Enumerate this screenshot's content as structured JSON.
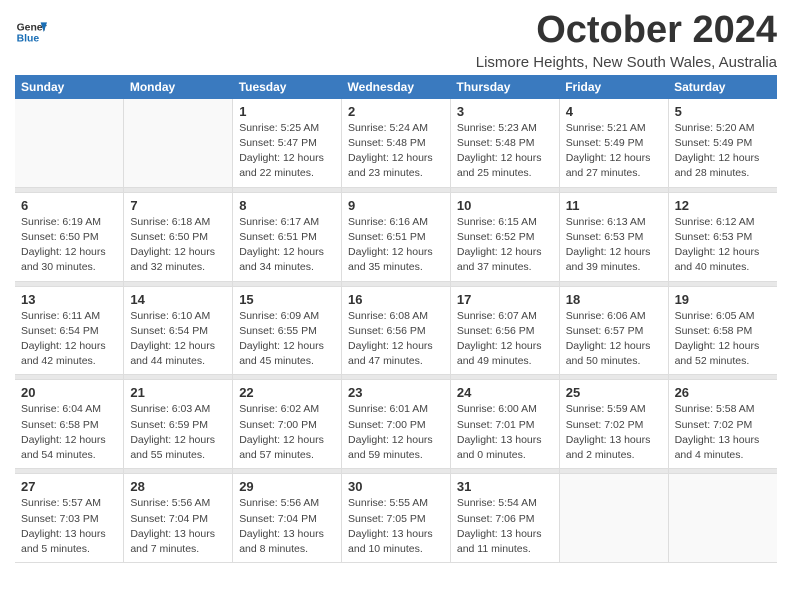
{
  "logo": {
    "line1": "General",
    "line2": "Blue"
  },
  "title": "October 2024",
  "subtitle": "Lismore Heights, New South Wales, Australia",
  "days_of_week": [
    "Sunday",
    "Monday",
    "Tuesday",
    "Wednesday",
    "Thursday",
    "Friday",
    "Saturday"
  ],
  "weeks": [
    [
      {
        "num": "",
        "info": ""
      },
      {
        "num": "",
        "info": ""
      },
      {
        "num": "1",
        "info": "Sunrise: 5:25 AM\nSunset: 5:47 PM\nDaylight: 12 hours\nand 22 minutes."
      },
      {
        "num": "2",
        "info": "Sunrise: 5:24 AM\nSunset: 5:48 PM\nDaylight: 12 hours\nand 23 minutes."
      },
      {
        "num": "3",
        "info": "Sunrise: 5:23 AM\nSunset: 5:48 PM\nDaylight: 12 hours\nand 25 minutes."
      },
      {
        "num": "4",
        "info": "Sunrise: 5:21 AM\nSunset: 5:49 PM\nDaylight: 12 hours\nand 27 minutes."
      },
      {
        "num": "5",
        "info": "Sunrise: 5:20 AM\nSunset: 5:49 PM\nDaylight: 12 hours\nand 28 minutes."
      }
    ],
    [
      {
        "num": "6",
        "info": "Sunrise: 6:19 AM\nSunset: 6:50 PM\nDaylight: 12 hours\nand 30 minutes."
      },
      {
        "num": "7",
        "info": "Sunrise: 6:18 AM\nSunset: 6:50 PM\nDaylight: 12 hours\nand 32 minutes."
      },
      {
        "num": "8",
        "info": "Sunrise: 6:17 AM\nSunset: 6:51 PM\nDaylight: 12 hours\nand 34 minutes."
      },
      {
        "num": "9",
        "info": "Sunrise: 6:16 AM\nSunset: 6:51 PM\nDaylight: 12 hours\nand 35 minutes."
      },
      {
        "num": "10",
        "info": "Sunrise: 6:15 AM\nSunset: 6:52 PM\nDaylight: 12 hours\nand 37 minutes."
      },
      {
        "num": "11",
        "info": "Sunrise: 6:13 AM\nSunset: 6:53 PM\nDaylight: 12 hours\nand 39 minutes."
      },
      {
        "num": "12",
        "info": "Sunrise: 6:12 AM\nSunset: 6:53 PM\nDaylight: 12 hours\nand 40 minutes."
      }
    ],
    [
      {
        "num": "13",
        "info": "Sunrise: 6:11 AM\nSunset: 6:54 PM\nDaylight: 12 hours\nand 42 minutes."
      },
      {
        "num": "14",
        "info": "Sunrise: 6:10 AM\nSunset: 6:54 PM\nDaylight: 12 hours\nand 44 minutes."
      },
      {
        "num": "15",
        "info": "Sunrise: 6:09 AM\nSunset: 6:55 PM\nDaylight: 12 hours\nand 45 minutes."
      },
      {
        "num": "16",
        "info": "Sunrise: 6:08 AM\nSunset: 6:56 PM\nDaylight: 12 hours\nand 47 minutes."
      },
      {
        "num": "17",
        "info": "Sunrise: 6:07 AM\nSunset: 6:56 PM\nDaylight: 12 hours\nand 49 minutes."
      },
      {
        "num": "18",
        "info": "Sunrise: 6:06 AM\nSunset: 6:57 PM\nDaylight: 12 hours\nand 50 minutes."
      },
      {
        "num": "19",
        "info": "Sunrise: 6:05 AM\nSunset: 6:58 PM\nDaylight: 12 hours\nand 52 minutes."
      }
    ],
    [
      {
        "num": "20",
        "info": "Sunrise: 6:04 AM\nSunset: 6:58 PM\nDaylight: 12 hours\nand 54 minutes."
      },
      {
        "num": "21",
        "info": "Sunrise: 6:03 AM\nSunset: 6:59 PM\nDaylight: 12 hours\nand 55 minutes."
      },
      {
        "num": "22",
        "info": "Sunrise: 6:02 AM\nSunset: 7:00 PM\nDaylight: 12 hours\nand 57 minutes."
      },
      {
        "num": "23",
        "info": "Sunrise: 6:01 AM\nSunset: 7:00 PM\nDaylight: 12 hours\nand 59 minutes."
      },
      {
        "num": "24",
        "info": "Sunrise: 6:00 AM\nSunset: 7:01 PM\nDaylight: 13 hours\nand 0 minutes."
      },
      {
        "num": "25",
        "info": "Sunrise: 5:59 AM\nSunset: 7:02 PM\nDaylight: 13 hours\nand 2 minutes."
      },
      {
        "num": "26",
        "info": "Sunrise: 5:58 AM\nSunset: 7:02 PM\nDaylight: 13 hours\nand 4 minutes."
      }
    ],
    [
      {
        "num": "27",
        "info": "Sunrise: 5:57 AM\nSunset: 7:03 PM\nDaylight: 13 hours\nand 5 minutes."
      },
      {
        "num": "28",
        "info": "Sunrise: 5:56 AM\nSunset: 7:04 PM\nDaylight: 13 hours\nand 7 minutes."
      },
      {
        "num": "29",
        "info": "Sunrise: 5:56 AM\nSunset: 7:04 PM\nDaylight: 13 hours\nand 8 minutes."
      },
      {
        "num": "30",
        "info": "Sunrise: 5:55 AM\nSunset: 7:05 PM\nDaylight: 13 hours\nand 10 minutes."
      },
      {
        "num": "31",
        "info": "Sunrise: 5:54 AM\nSunset: 7:06 PM\nDaylight: 13 hours\nand 11 minutes."
      },
      {
        "num": "",
        "info": ""
      },
      {
        "num": "",
        "info": ""
      }
    ]
  ]
}
